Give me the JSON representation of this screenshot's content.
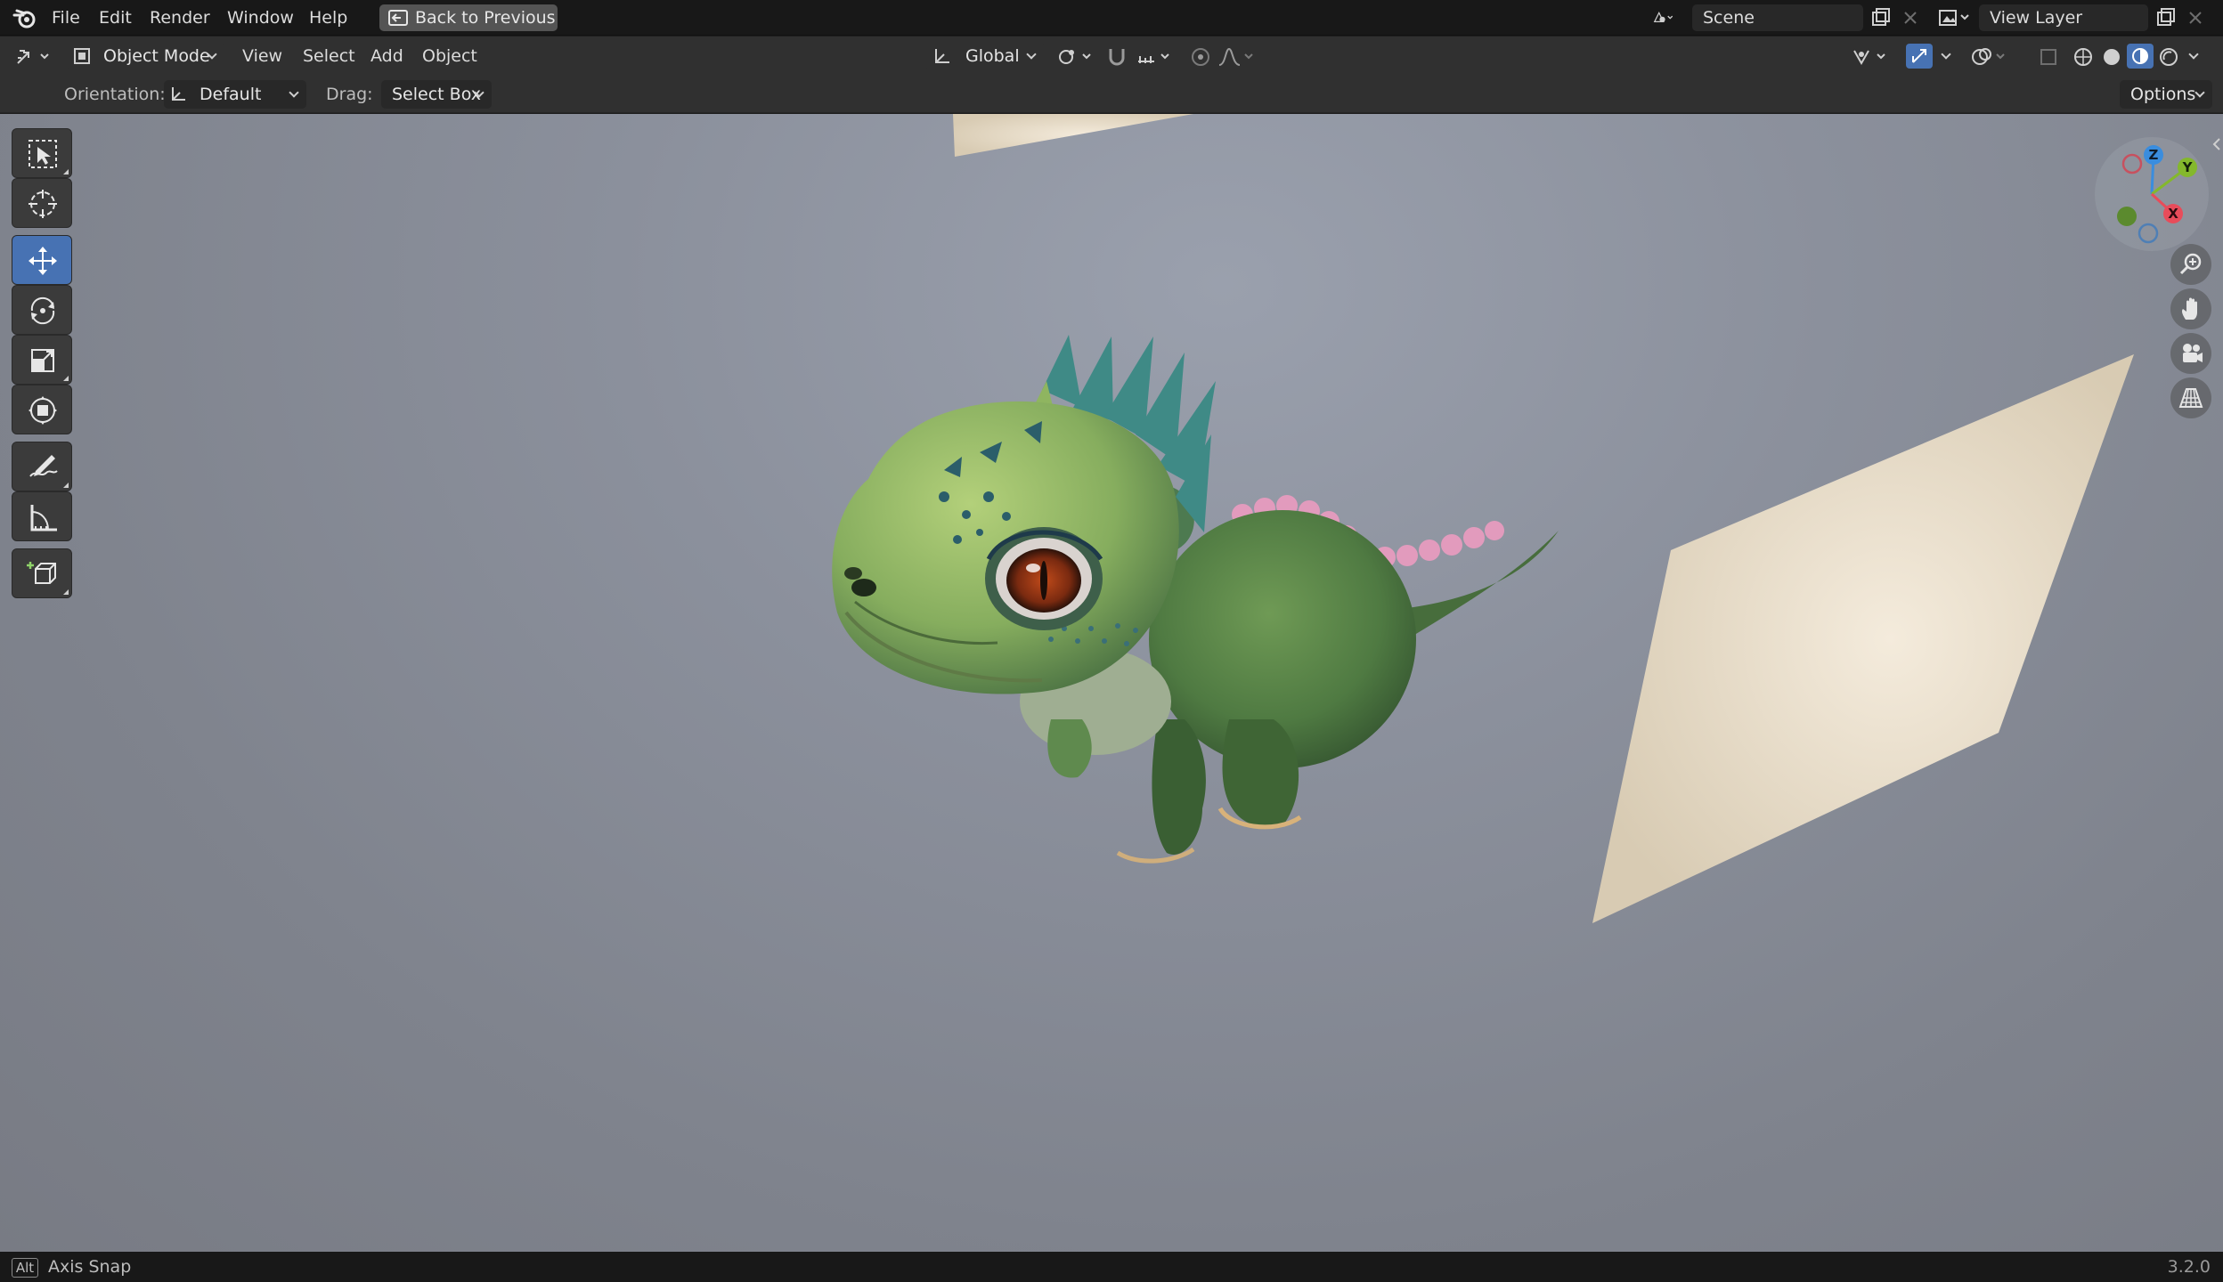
{
  "topbar": {
    "menu": [
      "File",
      "Edit",
      "Render",
      "Window",
      "Help"
    ],
    "back_button": "Back to Previous",
    "scene_field": "Scene",
    "view_layer_field": "View Layer"
  },
  "header": {
    "mode": "Object Mode",
    "menus": [
      "View",
      "Select",
      "Add",
      "Object"
    ],
    "transform_orientation": "Global"
  },
  "tool_settings": {
    "orientation_label": "Orientation:",
    "orientation_value": "Default",
    "drag_label": "Drag:",
    "drag_value": "Select Box",
    "options_label": "Options"
  },
  "toolbar": {
    "tools": [
      "select-box",
      "cursor",
      "move",
      "rotate",
      "scale",
      "transform",
      "annotate",
      "measure",
      "add-cube"
    ],
    "active_tool": "move"
  },
  "gizmo": {
    "axes": [
      "Z",
      "Y",
      "X"
    ],
    "colors": {
      "x": "#e84c5a",
      "y": "#84b82c",
      "z": "#3a8dde"
    }
  },
  "statusbar": {
    "key": "Alt",
    "hint": "Axis Snap",
    "version": "3.2.0"
  }
}
